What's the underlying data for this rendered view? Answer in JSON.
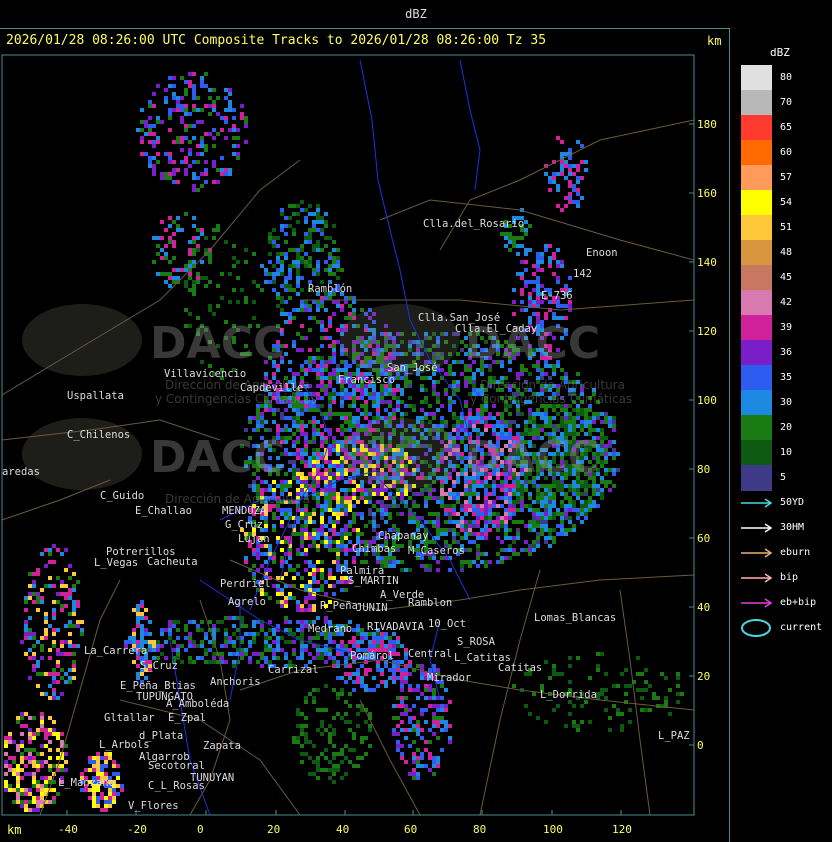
{
  "window_title": "dBZ",
  "header": "2026/01/28 08:26:00 UTC Composite Tracks to 2026/01/28 08:26:00 Tz 35",
  "km_label": "km",
  "legend": {
    "title": "dBZ",
    "bins": [
      {
        "label": "80",
        "color": "#e0e0e0"
      },
      {
        "label": "70",
        "color": "#b8b8b8"
      },
      {
        "label": "65",
        "color": "#ff3b2f"
      },
      {
        "label": "60",
        "color": "#ff6a00"
      },
      {
        "label": "57",
        "color": "#ff9a5a"
      },
      {
        "label": "54",
        "color": "#ffff00"
      },
      {
        "label": "51",
        "color": "#ffc83a"
      },
      {
        "label": "48",
        "color": "#d9953e"
      },
      {
        "label": "45",
        "color": "#c87860"
      },
      {
        "label": "42",
        "color": "#d87ab0"
      },
      {
        "label": "39",
        "color": "#d0209a"
      },
      {
        "label": "36",
        "color": "#7a1fc8"
      },
      {
        "label": "35",
        "color": "#2d5cf0"
      },
      {
        "label": "30",
        "color": "#1d88e0"
      },
      {
        "label": "20",
        "color": "#1a7a14"
      },
      {
        "label": "10",
        "color": "#0f5a12"
      },
      {
        "label": "5",
        "color": "#3e3a88"
      }
    ]
  },
  "tracks": [
    {
      "label": "50YD",
      "color": "#4ad8e0"
    },
    {
      "label": "30HM",
      "color": "#ffffff"
    },
    {
      "label": "eburn",
      "color": "#f0b070"
    },
    {
      "label": "bip",
      "color": "#ffb0b0"
    },
    {
      "label": "eb+bip",
      "color": "#e040e0"
    },
    {
      "label": "current",
      "color": "#4ad8e0"
    }
  ],
  "y_ticks": [
    "180",
    "160",
    "140",
    "120",
    "100",
    "80",
    "60",
    "40",
    "20",
    "0"
  ],
  "x_ticks": [
    "-40",
    "-20",
    "0",
    "20",
    "40",
    "60",
    "80",
    "100",
    "120"
  ],
  "places": [
    "Clla.del_Rosario",
    "Enoon",
    "142",
    "E-736",
    "Ramblón",
    "Clla.San_José",
    "Clla.El_Caday",
    "San_José",
    "Francisco",
    "Capdeville",
    "Villavicencio",
    "Uspallata",
    "C_Chilenos",
    "aredas",
    "C_Guido",
    "E_Challao",
    "MENDOZA",
    "G_Cruz",
    "Lujan",
    "Potrerillos",
    "Cacheuta",
    "L_Vegas",
    "Perdriel",
    "Agrelo",
    "Chimbas",
    "Chapanay",
    "M_Caseros",
    "Palmira",
    "S_MARTIN",
    "A_Verde",
    "Ramblon",
    "R_Peña",
    "JUNIN",
    "RIVADAVIA",
    "10_Oct",
    "S_ROSA",
    "Lomas_Blancas",
    "La_Carrera",
    "S_Cruz",
    "E_Peña_Btias",
    "TUPUNGATO",
    "Anchoris",
    "Carrizal",
    "Medrano",
    "L_Catitas",
    "Catitas",
    "Mirador",
    "L_Dorrida",
    "E_Zpal",
    "Gltallar",
    "A_Amboléda",
    "d_Plata",
    "L_Arbols",
    "Algarrob",
    "Zapata",
    "Secotoral",
    "TUNUYAN",
    "C_L_Rosas",
    "V_Flores",
    "L_Manzano",
    "L_PAZ",
    "Central",
    "Pomárol"
  ],
  "watermark": {
    "logo_text": "DACC",
    "line1": "Dirección de Agricultura",
    "line2": "y Contingencias Climáticas"
  }
}
